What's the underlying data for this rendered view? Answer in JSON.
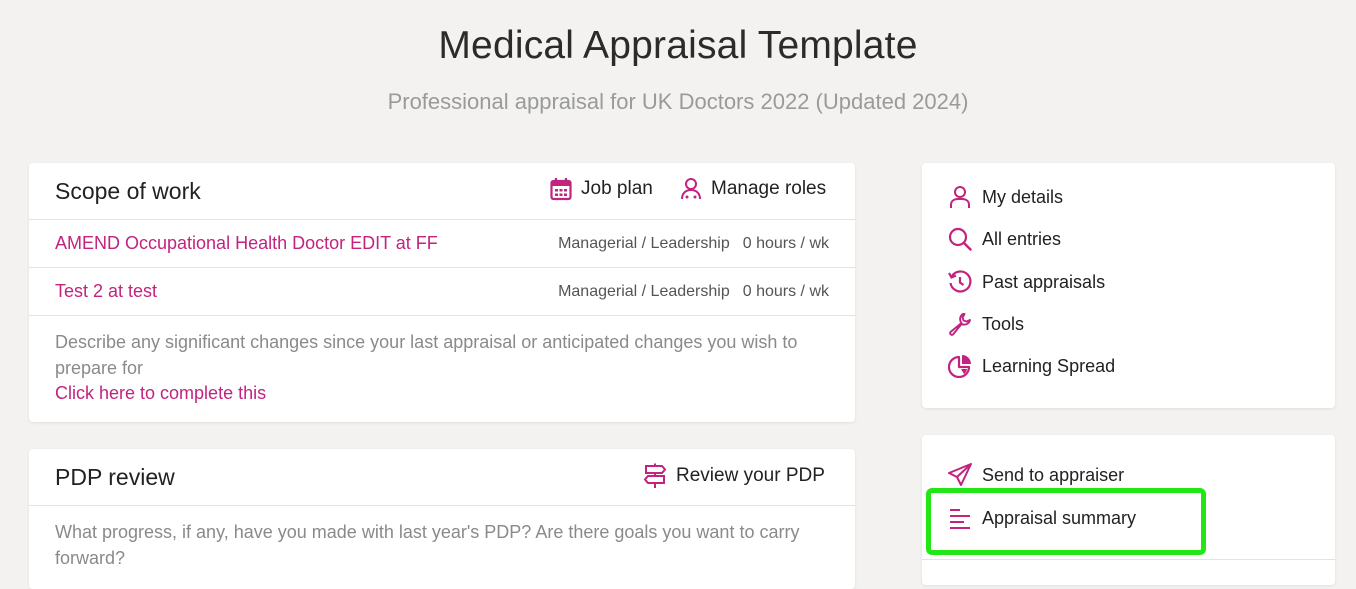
{
  "header": {
    "title": "Medical Appraisal Template",
    "subtitle": "Professional appraisal for UK Doctors 2022 (Updated 2024)"
  },
  "scope": {
    "title": "Scope of work",
    "job_plan_label": "Job plan",
    "manage_roles_label": "Manage roles",
    "roles": [
      {
        "name": "AMEND Occupational Health Doctor EDIT at FF",
        "category": "Managerial / Leadership",
        "hours": "0 hours / wk"
      },
      {
        "name": "Test 2 at test",
        "category": "Managerial / Leadership",
        "hours": "0 hours / wk"
      }
    ],
    "description": "Describe any significant changes since your last appraisal or anticipated changes you wish to prepare for",
    "complete_link": "Click here to complete this"
  },
  "pdp": {
    "title": "PDP review",
    "review_label": "Review your PDP",
    "description": "What progress, if any, have you made with last year's PDP? Are there goals you want to carry forward?"
  },
  "sidebar": {
    "menu": [
      {
        "label": "My details",
        "icon": "user-icon"
      },
      {
        "label": "All entries",
        "icon": "search-icon"
      },
      {
        "label": "Past appraisals",
        "icon": "history-icon"
      },
      {
        "label": "Tools",
        "icon": "wrench-icon"
      },
      {
        "label": "Learning Spread",
        "icon": "pie-chart-icon"
      }
    ],
    "actions": [
      {
        "label": "Send to appraiser",
        "icon": "send-icon"
      },
      {
        "label": "Appraisal summary",
        "icon": "align-left-icon"
      }
    ]
  },
  "colors": {
    "accent": "#c2237f",
    "highlight": "#22e616",
    "background": "#f3f2f1"
  }
}
